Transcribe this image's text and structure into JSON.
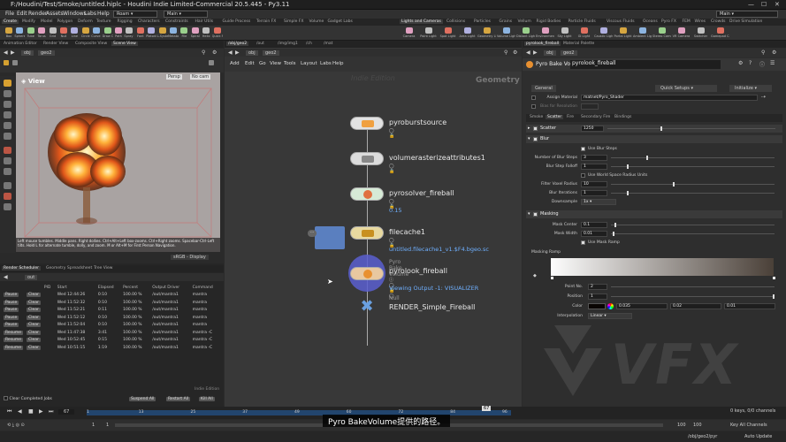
{
  "titlebar": {
    "title": "F:/Houdini/Test/Smoke/untitled.hiplc - Houdini Indie Limited-Commercial 20.5.445 - Py3.11"
  },
  "menus": [
    "File",
    "Edit",
    "Render",
    "Assets",
    "Windows",
    "Labs",
    "Help"
  ],
  "desktops": {
    "build": "Roam",
    "main": "Main",
    "right": "Main"
  },
  "shelf_tabs_left": [
    "Create",
    "Modify",
    "Model",
    "Polygon",
    "Deform",
    "Texture",
    "Rigging",
    "Characters",
    "Constraints",
    "Hair Utils",
    "Guide Process",
    "Terrain FX",
    "Simple FX",
    "Volume",
    "Gadget Labs"
  ],
  "shelf_tabs_right": [
    "Lights and Cameras",
    "Collisions",
    "Particles",
    "Grains",
    "Vellum",
    "Rigid Bodies",
    "Particle Fluids",
    "Viscous Fluids",
    "Oceans",
    "Pyro FX",
    "FEM",
    "Wires",
    "Crowds",
    "Drive Simulation"
  ],
  "tools_left": [
    "Box",
    "Sphere",
    "Tube",
    "Torus",
    "Grid",
    "Null",
    "Line",
    "Circle",
    "Curve Bezier",
    "Draw Curve",
    "Path",
    "Spray Paint",
    "Font",
    "Platonic Solids",
    "L-System",
    "Metaball",
    "File",
    "Spiral",
    "Helix",
    "Quick Shapes"
  ],
  "tools_right": [
    "Camera",
    "Point Light",
    "Spot Light",
    "Area Light",
    "Geometry Light",
    "Volume Light",
    "Distant Light",
    "Environment Light",
    "Sky Light",
    "GI Light",
    "Caustic Light",
    "Portal Light",
    "Ambient Light",
    "Stereo Camera",
    "VR Camera",
    "Switcher",
    "Gamepad Camera"
  ],
  "left_tabs": [
    "Animation Editor",
    "Render View",
    "Composite View",
    "Scene View"
  ],
  "left_path": [
    "obj",
    "geo2"
  ],
  "viewport": {
    "label": "View",
    "persp": "Persp",
    "cam": "No cam",
    "help": "Left mouse tumbles. Middle pans. Right dollies. Ctrl+Alt+Left box-zooms. Ctrl+Right zooms. Spacebar-Ctrl-Left tilts. Hold L for alternate tumble, dolly, and zoom. M or Alt+M for First Person Navigation.",
    "srgb": "sRGB - Display"
  },
  "scheduler_tabs": [
    "Render Scheduler",
    "Geometry Spreadsheet",
    "Tree View"
  ],
  "scheduler_filter": "out",
  "scheduler_cols": [
    "PID",
    "Start",
    "Elapsed",
    "Percent",
    "Output Driver",
    "Command"
  ],
  "scheduler_rows": [
    [
      "Pause",
      "Clear",
      "",
      "Wed 12:44:26",
      "0:10",
      "100.00 %",
      "/out/mantra1",
      "mantra"
    ],
    [
      "Pause",
      "Clear",
      "",
      "Wed 11:52:32",
      "0:10",
      "100.00 %",
      "/out/mantra1",
      "mantra"
    ],
    [
      "Pause",
      "Clear",
      "",
      "Wed 11:52:21",
      "0:11",
      "100.00 %",
      "/out/mantra1",
      "mantra"
    ],
    [
      "Pause",
      "Clear",
      "",
      "Wed 11:52:12",
      "0:10",
      "100.00 %",
      "/out/mantra1",
      "mantra"
    ],
    [
      "Pause",
      "Clear",
      "",
      "Wed 11:52:04",
      "0:10",
      "100.00 %",
      "/out/mantra1",
      "mantra"
    ],
    [
      "Resume",
      "Clear",
      "",
      "Wed 11:47:38",
      "3:41",
      "100.00 %",
      "/out/mantra1",
      "mantra -C"
    ],
    [
      "Resume",
      "Clear",
      "",
      "Wed 10:52:45",
      "0:15",
      "100.00 %",
      "/out/mantra1",
      "mantra -C"
    ],
    [
      "Resume",
      "Clear",
      "",
      "Wed 10:51:15",
      "1:19",
      "100.00 %",
      "/out/mantra1",
      "mantra -C"
    ]
  ],
  "scheduler_footer": {
    "clear_completed": "Clear Completed Jobs",
    "suspend": "Suspend All",
    "restart": "Restart All",
    "kill": "Kill All",
    "edition": "Indie Edition"
  },
  "net_tabs": [
    "/obj/geo2",
    "/out",
    "/img/img1",
    "/ch",
    "/mat"
  ],
  "net_path": [
    "obj",
    "geo2"
  ],
  "net_menu": [
    "Add",
    "Edit",
    "Go",
    "View",
    "Tools",
    "Layout",
    "Labs",
    "Help"
  ],
  "net_watermark": "Indie Edition",
  "net_context": "Geometry",
  "nodes": [
    {
      "name": "pyroburstsource",
      "sub": ""
    },
    {
      "name": "volumerasterizeattributes1",
      "sub": ""
    },
    {
      "name": "pyrosolver_fireball",
      "sub": "0.15"
    },
    {
      "name": "filecache1",
      "sub": "untitled.filecache1_v1.$F4.bgeo.sc"
    },
    {
      "name": "pyrolook_fireball",
      "type": "Pyro Bake Volume",
      "sub": "Viewing Output -1: VISUALIZER"
    },
    {
      "name": "RENDER_Simple_Fireball",
      "type": "Null",
      "sub": ""
    }
  ],
  "param_tabs": [
    "pyrolook_fireball",
    "Material Palette"
  ],
  "param_path": [
    "obj",
    "geo2"
  ],
  "param_header": {
    "type": "Pyro Bake Volume",
    "name": "pyrolook_fireball"
  },
  "params": {
    "general": "General",
    "quick_setups": "Quick Setups",
    "initialize": "Initialize",
    "assign_material_label": "Assign Material",
    "assign_material_value": "matnet/Pyro_Shader",
    "bias_label": "Bias for Resolution",
    "tabs": [
      "Smoke",
      "Scatter",
      "Fire",
      "Secondary Fire",
      "Bindings"
    ],
    "scatter_label": "Scatter",
    "scatter_value": "1250",
    "blur_label": "Blur",
    "use_blur_steps": "Use Blur Steps",
    "blur_steps_label": "Number of Blur Steps",
    "blur_steps_value": "3",
    "blur_falloff_label": "Blur Step Falloff",
    "blur_falloff_value": "1",
    "use_world_radius": "Use World Space Radius Units",
    "filter_radius_label": "Filter Voxel Radius",
    "filter_radius_value": "10",
    "blur_iter_label": "Blur Iterations",
    "blur_iter_value": "1",
    "downsample_label": "Downsample",
    "downsample_value": "1x",
    "masking_label": "Masking",
    "mask_center_label": "Mask Center",
    "mask_center_value": "0.1",
    "mask_width_label": "Mask Width",
    "mask_width_value": "0.01",
    "use_mask_ramp": "Use Mask Ramp",
    "masking_ramp_label": "Masking Ramp",
    "point_no_label": "Point No.",
    "point_no_value": "2",
    "position_label": "Position",
    "position_value": "1",
    "color_label": "Color",
    "color_values": [
      "0.035",
      "0.02",
      "0.01"
    ],
    "interp_label": "Interpolation",
    "interp_value": "Linear"
  },
  "watermark": "VFX",
  "subtitle": "Pyro BakeVolume提供的路径。",
  "timeline": {
    "frame": "67",
    "start": "1",
    "start2": "1",
    "end": "100",
    "end2": "100",
    "current_marker": "67",
    "ticks": [
      "1",
      "13",
      "25",
      "37",
      "49",
      "60",
      "72",
      "84",
      "96"
    ],
    "keys": "0 keys, 0/0 channels",
    "key_all": "Key All Channels",
    "auto_update": "Auto Update",
    "path": "/obj/geo2/pyr"
  }
}
